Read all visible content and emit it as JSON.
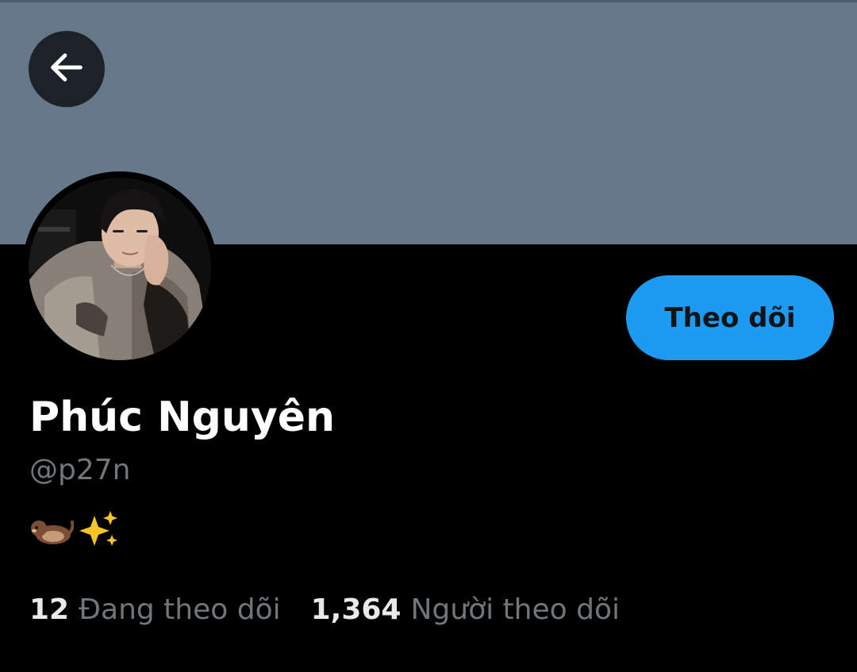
{
  "header": {
    "back_icon": "arrow-left-icon",
    "banner_color": "#66788a"
  },
  "profile": {
    "avatar": "profile-photo",
    "follow_label": "Theo dõi",
    "display_name": "Phúc Nguyên",
    "handle": "@p27n",
    "bio_icons": [
      "otter-emoji",
      "sparkles-emoji"
    ]
  },
  "stats": {
    "following_count": "12",
    "following_label": "Đang theo dõi",
    "followers_count": "1,364",
    "followers_label": "Người theo dõi"
  },
  "colors": {
    "accent": "#1d9bf0",
    "background": "#000000",
    "secondary_text": "#71767b"
  }
}
